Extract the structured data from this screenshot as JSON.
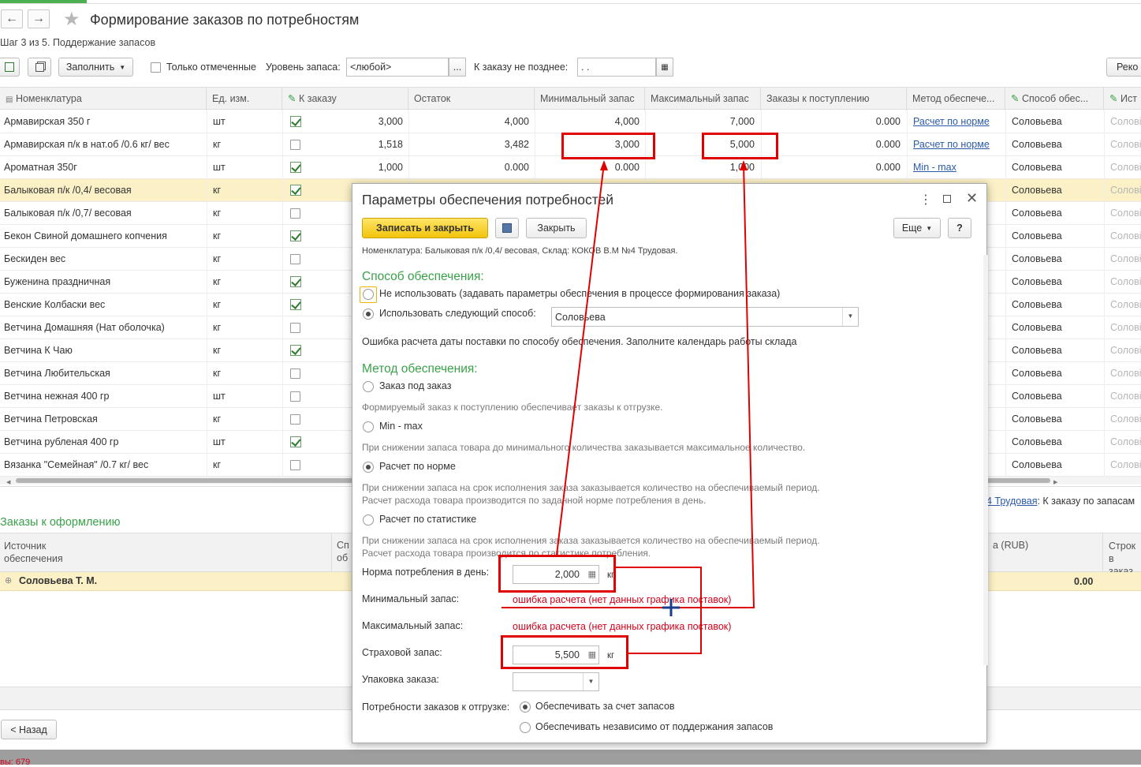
{
  "window": {
    "title": "Формирование заказов по потребностям",
    "step": "Шаг 3 из 5. Поддержание запасов"
  },
  "toolbar": {
    "fill_label": "Заполнить",
    "only_marked_label": "Только отмеченные",
    "stock_level_label": "Уровень запаса:",
    "stock_level_value": "<любой>",
    "order_before_label": "К заказу не позднее:",
    "order_before_value": " .  .",
    "recommend_label": "Реко"
  },
  "grid": {
    "columns": [
      "Номенклатура",
      "Ед. изм.",
      "К заказу",
      "Остаток",
      "Минимальный запас",
      "Максимальный запас",
      "Заказы к поступлению",
      "Метод обеспече...",
      "Способ обес...",
      "Ист"
    ],
    "rows": [
      {
        "name": "Армавирская 350 г",
        "unit": "шт",
        "checked": true,
        "order": "3,000",
        "rest": "4,000",
        "min": "4,000",
        "max": "7,000",
        "incoming": "0.000",
        "method": "Расчет по норме",
        "way": "Соловьева",
        "src": "Солові"
      },
      {
        "name": "Армавирская п/к в нат.об /0.6 кг/ вес",
        "unit": "кг",
        "checked": false,
        "order": "1,518",
        "rest": "3,482",
        "min": "3,000",
        "max": "5,000",
        "incoming": "0.000",
        "method": "Расчет по норме",
        "way": "Соловьева",
        "src": "Солові"
      },
      {
        "name": "Ароматная 350г",
        "unit": "шт",
        "checked": true,
        "order": "1,000",
        "rest": "0.000",
        "min": "0.000",
        "max": "1,000",
        "incoming": "0.000",
        "method": "Min - max",
        "way": "Соловьева",
        "src": "Солові"
      },
      {
        "name": "Балыковая п/к /0,4/ весовая",
        "unit": "кг",
        "checked": true,
        "order": "",
        "rest": "",
        "min": "",
        "max": "",
        "incoming": "",
        "method": "",
        "way": "Соловьева",
        "src": "Солові"
      },
      {
        "name": "Балыковая п/к /0,7/ весовая",
        "unit": "кг",
        "checked": false,
        "order": "",
        "rest": "",
        "min": "",
        "max": "",
        "incoming": "",
        "method": "е",
        "way": "Соловьева",
        "src": "Солові"
      },
      {
        "name": "Бекон Свиной домашнего копчения",
        "unit": "кг",
        "checked": true,
        "order": "",
        "rest": "",
        "min": "",
        "max": "",
        "incoming": "",
        "method": "е",
        "way": "Соловьева",
        "src": "Солові"
      },
      {
        "name": "Бескиден вес",
        "unit": "кг",
        "checked": false,
        "order": "",
        "rest": "",
        "min": "",
        "max": "",
        "incoming": "",
        "method": "е",
        "way": "Соловьева",
        "src": "Солові"
      },
      {
        "name": "Буженина праздничная",
        "unit": "кг",
        "checked": true,
        "order": "",
        "rest": "",
        "min": "",
        "max": "",
        "incoming": "",
        "method": "е",
        "way": "Соловьева",
        "src": "Солові"
      },
      {
        "name": "Венские Колбаски вес",
        "unit": "кг",
        "checked": true,
        "order": "",
        "rest": "",
        "min": "",
        "max": "",
        "incoming": "",
        "method": "е",
        "way": "Соловьева",
        "src": "Солові"
      },
      {
        "name": "Ветчина Домашняя (Нат оболочка)",
        "unit": "кг",
        "checked": false,
        "order": "",
        "rest": "",
        "min": "",
        "max": "",
        "incoming": "",
        "method": "е",
        "way": "Соловьева",
        "src": "Солові"
      },
      {
        "name": "Ветчина К Чаю",
        "unit": "кг",
        "checked": true,
        "order": "",
        "rest": "",
        "min": "",
        "max": "",
        "incoming": "",
        "method": "е",
        "way": "Соловьева",
        "src": "Солові"
      },
      {
        "name": "Ветчина Любительская",
        "unit": "кг",
        "checked": false,
        "order": "",
        "rest": "",
        "min": "",
        "max": "",
        "incoming": "",
        "method": "е",
        "way": "Соловьева",
        "src": "Солові"
      },
      {
        "name": "Ветчина нежная 400 гр",
        "unit": "шт",
        "checked": false,
        "order": "",
        "rest": "",
        "min": "",
        "max": "",
        "incoming": "",
        "method": "е",
        "way": "Соловьева",
        "src": "Солові"
      },
      {
        "name": "Ветчина Петровская",
        "unit": "кг",
        "checked": false,
        "order": "",
        "rest": "",
        "min": "",
        "max": "",
        "incoming": "",
        "method": "е",
        "way": "Соловьева",
        "src": "Солові"
      },
      {
        "name": "Ветчина рубленая 400 гр",
        "unit": "шт",
        "checked": true,
        "order": "",
        "rest": "",
        "min": "",
        "max": "",
        "incoming": "",
        "method": "е",
        "way": "Соловьева",
        "src": "Солові"
      },
      {
        "name": "Вязанка \"Семейная\" /0.7 кг/ вес",
        "unit": "кг",
        "checked": false,
        "order": "",
        "rest": "",
        "min": "",
        "max": "",
        "incoming": "",
        "method": "е",
        "way": "Соловьева",
        "src": "Солові"
      }
    ]
  },
  "info_line": {
    "link": "4 Трудовая",
    "text": ": К заказу по запасам"
  },
  "orders": {
    "title": "Заказы к оформлению",
    "col_source": "Источник\nобеспечения",
    "col_sp": "Сп",
    "col_ob": "об",
    "col_sum": "а (RUB)",
    "col_lines": "Строк\nв заказ",
    "group_name": "Соловьева Т. М.",
    "group_sum": "0.00"
  },
  "back_label": "< Назад",
  "status_text": "вы: 679",
  "dialog": {
    "title": "Параметры обеспечения потребностей",
    "save_close": "Записать и закрыть",
    "close": "Закрыть",
    "more": "Еще",
    "help": "?",
    "info": "Номенклатура: Балыковая п/к /0,4/ весовая, Склад: КОКОВ В.М №4 Трудовая.",
    "way_title": "Способ обеспечения:",
    "way_opt1": "Не использовать (задавать параметры обеспечения в процессе формирования заказа)",
    "way_opt2": "Использовать следующий способ:",
    "way_value": "Соловьева",
    "way_error": "Ошибка расчета даты поставки по способу обеспечения. Заполните календарь работы склада",
    "method_title": "Метод обеспечения:",
    "m1": "Заказ под заказ",
    "m1_hint": "Формируемый заказ к поступлению обеспечивает заказы к отгрузке.",
    "m2": "Min - max",
    "m2_hint": "При снижении запаса товара до минимального количества заказывается максимальное количество.",
    "m3": "Расчет по норме",
    "m3_hint1": "При снижении запаса на срок исполнения заказа заказывается количество на обеспечиваемый период.",
    "m3_hint2": "Расчет расхода товара производится по заданной норме потребления в день.",
    "m4": "Расчет по статистике",
    "m4_hint1": "При снижении запаса на срок исполнения заказа заказывается количество на обеспечиваемый период.",
    "m4_hint2": "Расчет расхода товара производится по статистике потребления.",
    "norm_label": "Норма потребления в день:",
    "norm_value": "2,000",
    "unit": "кг",
    "min_label": "Минимальный запас:",
    "min_error": "ошибка расчета (нет данных графика поставок)",
    "max_label": "Максимальный запас:",
    "max_error": "ошибка расчета (нет данных графика поставок)",
    "safety_label": "Страховой запас:",
    "safety_value": "5,500",
    "pack_label": "Упаковка заказа:",
    "demand_label": "Потребности заказов к отгрузке:",
    "d1": "Обеспечивать за счет запасов",
    "d2": "Обеспечивать независимо от поддержания запасов"
  },
  "colors": {
    "accent_green": "#3aa14a",
    "highlight_row": "#fbf0c6",
    "annotation_red": "#e00000",
    "link_blue": "#2a5aa9",
    "button_yellow": "#f7d21a"
  }
}
